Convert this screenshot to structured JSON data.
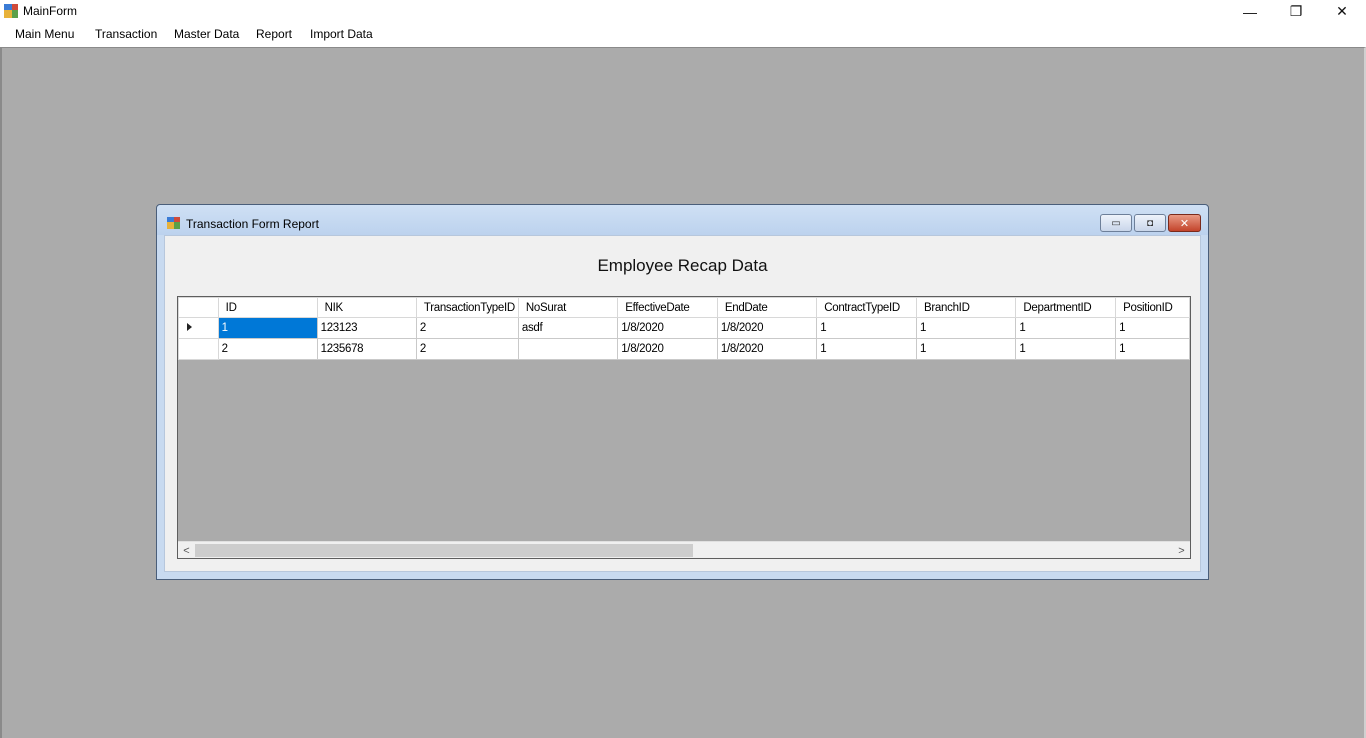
{
  "window": {
    "title": "MainForm",
    "controls": {
      "minimize": "—",
      "restore": "❐",
      "close": "✕"
    },
    "icon": "app-form-icon"
  },
  "menu": {
    "items": [
      {
        "label": "Main Menu"
      },
      {
        "label": "Transaction"
      },
      {
        "label": "Master Data"
      },
      {
        "label": "Report"
      },
      {
        "label": "Import Data"
      }
    ]
  },
  "child_window": {
    "title": "Transaction Form Report",
    "icon": "form-icon",
    "controls": {
      "minimize": "▭",
      "maximize": "◘",
      "close": "✕"
    },
    "heading": "Employee Recap Data"
  },
  "grid": {
    "columns": [
      "ID",
      "NIK",
      "TransactionTypeID",
      "NoSurat",
      "EffectiveDate",
      "EndDate",
      "ContractTypeID",
      "BranchID",
      "DepartmentID",
      "PositionID"
    ],
    "rows": [
      [
        "1",
        "123123",
        "2",
        "asdf",
        "1/8/2020",
        "1/8/2020",
        "1",
        "1",
        "1",
        "1"
      ],
      [
        "2",
        "1235678",
        "2",
        "",
        "1/8/2020",
        "1/8/2020",
        "1",
        "1",
        "1",
        "1"
      ]
    ],
    "current_row": 0,
    "scroll": {
      "left": "<",
      "right": ">"
    }
  },
  "colors": {
    "mdi_background": "#ababab",
    "selection": "#0078d7",
    "close_button": "#c3442b"
  }
}
